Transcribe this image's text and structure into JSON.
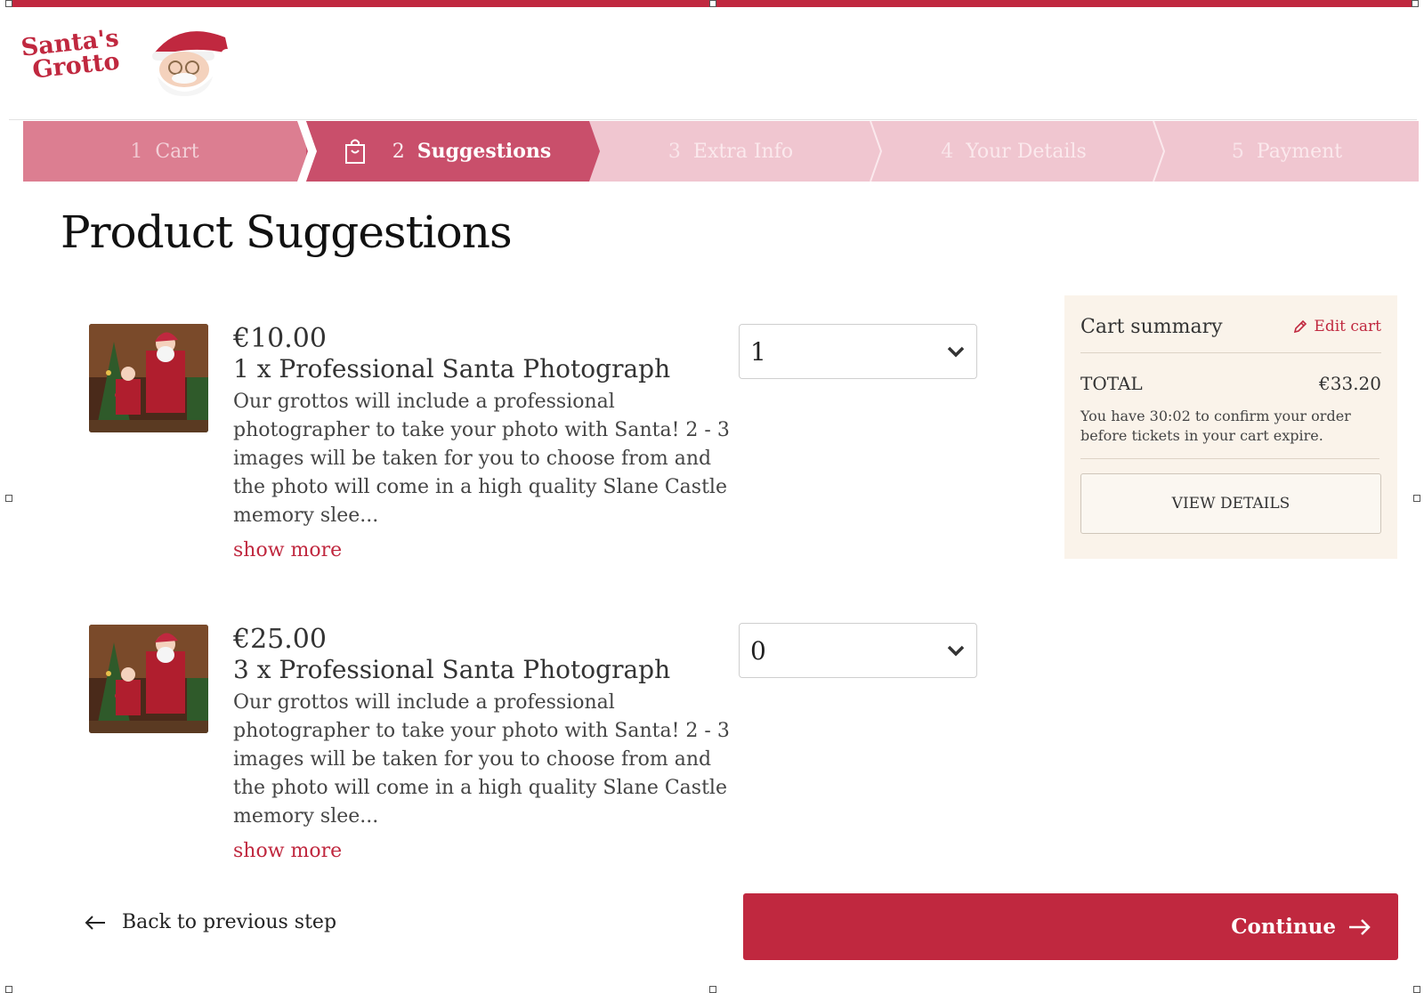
{
  "brand": {
    "logo_text_line1": "Santa's",
    "logo_text_line2": "Grotto",
    "color": "#c0283f"
  },
  "stepper": [
    {
      "num": "1",
      "label": "Cart",
      "state": "done"
    },
    {
      "num": "2",
      "label": "Suggestions",
      "state": "active"
    },
    {
      "num": "3",
      "label": "Extra Info",
      "state": "todo"
    },
    {
      "num": "4",
      "label": "Your Details",
      "state": "todo"
    },
    {
      "num": "5",
      "label": "Payment",
      "state": "todo"
    }
  ],
  "page_title": "Product Suggestions",
  "products": [
    {
      "price": "€10.00",
      "name": "1 x Professional Santa Photograph",
      "description": "Our grottos will include a professional photographer to take your photo with Santa! 2 - 3 images will be taken for you to choose from and the photo will come in a high quality Slane Castle memory slee...",
      "show_more": "show more",
      "quantity": "1"
    },
    {
      "price": "€25.00",
      "name": "3 x Professional Santa Photograph",
      "description": "Our grottos will include a professional photographer to take your photo with Santa! 2 - 3 images will be taken for you to choose from and the photo will come in a high quality Slane Castle memory slee...",
      "show_more": "show more",
      "quantity": "0"
    }
  ],
  "cart_summary": {
    "title": "Cart summary",
    "edit_label": "Edit cart",
    "total_label": "TOTAL",
    "total_value": "€33.20",
    "timer_text": "You have 30:02 to confirm your order before tickets in your cart expire.",
    "view_details": "VIEW DETAILS"
  },
  "footer": {
    "back_label": "Back to previous step",
    "continue_label": "Continue"
  }
}
